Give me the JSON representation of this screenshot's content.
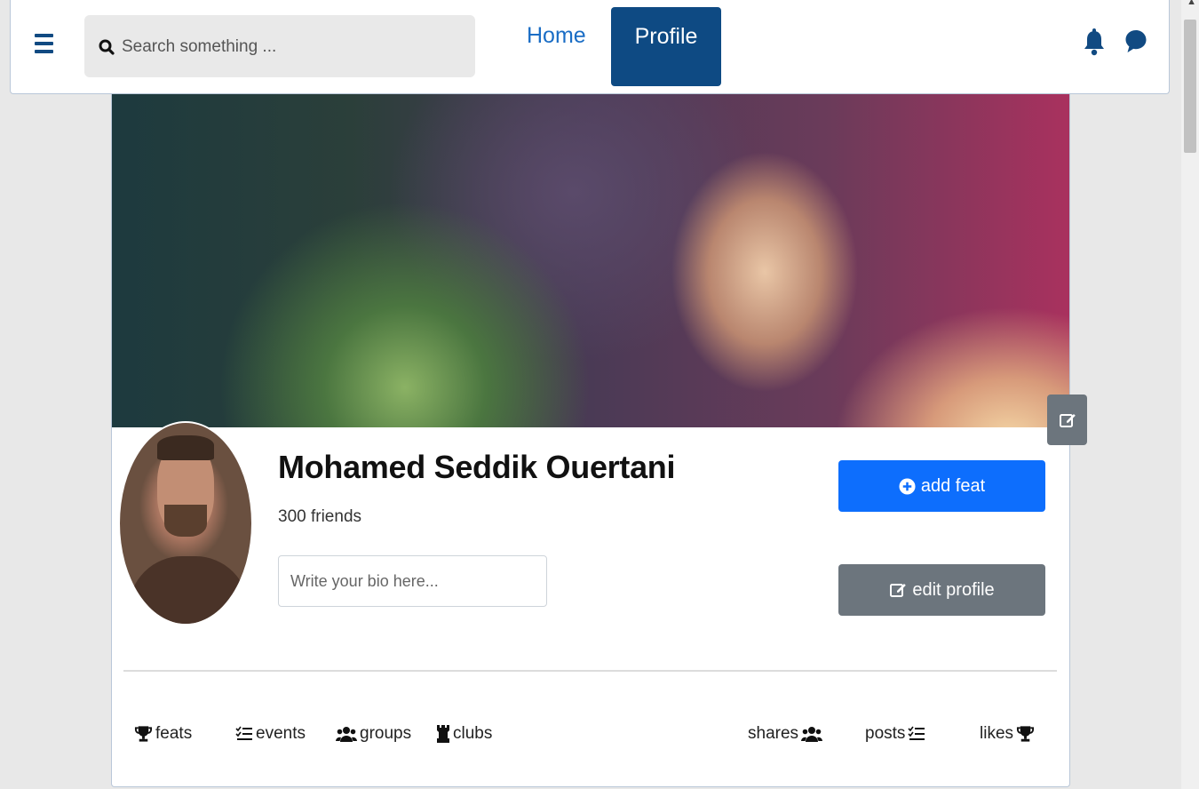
{
  "navbar": {
    "search_placeholder": "Search something ...",
    "home_label": "Home",
    "profile_label": "Profile"
  },
  "profile": {
    "name": "Mohamed Seddik Ouertani",
    "friends": "300 friends",
    "bio_placeholder": "Write your bio here...",
    "add_feat_label": "add feat",
    "edit_profile_label": "edit profile"
  },
  "tabs_left": [
    "feats",
    "events",
    "groups",
    "clubs"
  ],
  "tabs_right": [
    "shares",
    "posts",
    "likes"
  ],
  "colors": {
    "primary_dark": "#0e4a83",
    "link": "#1a6dc5",
    "button_primary": "#0d6efd",
    "button_secondary": "#6c757d"
  }
}
